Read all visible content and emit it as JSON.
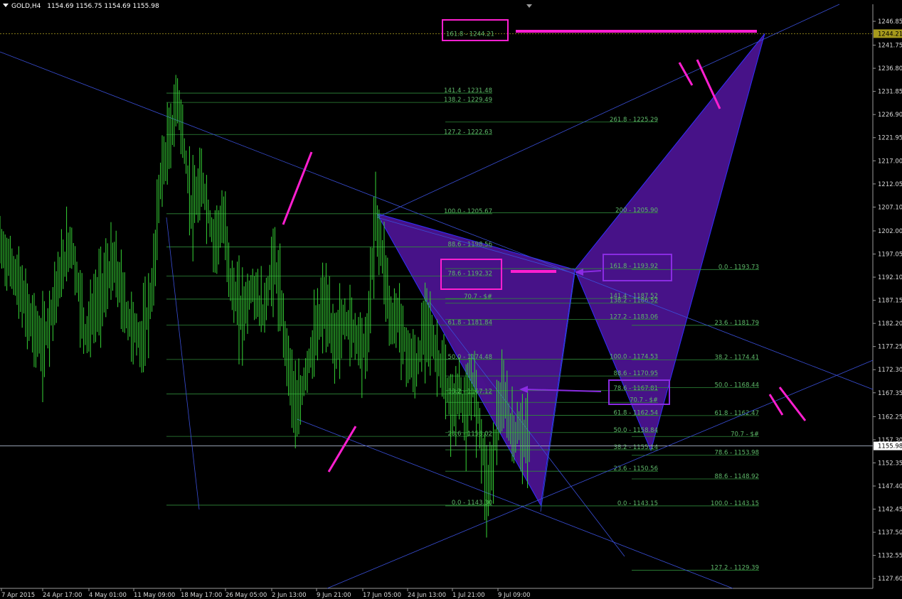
{
  "header": {
    "symbol": "GOLD,H4",
    "ohlc": "1154.69 1156.75 1154.69 1155.98"
  },
  "chart_data": {
    "type": "candlestick",
    "symbol": "GOLD,H4",
    "ylim": [
      1125.5,
      1250.5
    ],
    "y_ticks": [
      "1246.85",
      "1241.75",
      "1236.80",
      "1231.85",
      "1226.90",
      "1221.95",
      "1217.00",
      "1212.05",
      "1207.10",
      "1202.00",
      "1197.05",
      "1192.10",
      "1187.15",
      "1182.20",
      "1177.25",
      "1172.30",
      "1167.35",
      "1162.25",
      "1157.30",
      "1152.35",
      "1147.40",
      "1142.45",
      "1137.50",
      "1132.55",
      "1127.60"
    ],
    "x_ticks": [
      "7 Apr 2015",
      "24 Apr 17:00",
      "4 May 01:00",
      "11 May 09:00",
      "18 May 17:00",
      "26 May 05:00",
      "2 Jun 13:00",
      "9 Jun 21:00",
      "17 Jun 05:00",
      "24 Jun 13:00",
      "1 Jul 21:00",
      "9 Jul 09:00"
    ],
    "current_price": "1155.98",
    "target_price": "1244.21",
    "fib_set_1": [
      {
        "label": "141.4 - 1231.48",
        "value": 1231.48
      },
      {
        "label": "138.2 - 1229.49",
        "value": 1229.49
      },
      {
        "label": "127.2 - 1222.63",
        "value": 1222.63
      },
      {
        "label": "100.0 - 1205.67",
        "value": 1205.67
      },
      {
        "label": "88.6 - 1198.56",
        "value": 1198.56
      },
      {
        "label": "78.6 - 1192.32",
        "value": 1192.32
      },
      {
        "label": "70.7 - $#",
        "value": 1187.4
      },
      {
        "label": "61.8 - 1181.84",
        "value": 1181.84
      },
      {
        "label": "50.0 - 1174.48",
        "value": 1174.48
      },
      {
        "label": "38.2 - 1167.12",
        "value": 1167.12
      },
      {
        "label": "23.6 - 1158.02",
        "value": 1158.02
      },
      {
        "label": "0.0 - 1143.30",
        "value": 1143.3
      }
    ],
    "fib_set_2": [
      {
        "label": "261.8 - 1225.29",
        "value": 1225.29
      },
      {
        "label": "200 - 1205.90",
        "value": 1205.9
      },
      {
        "label": "161.8 - 1193.92",
        "value": 1193.92
      },
      {
        "label": "141.4 - 1187.52",
        "value": 1187.52
      },
      {
        "label": "138.2 - 1186.52",
        "value": 1186.52
      },
      {
        "label": "127.2 - 1183.06",
        "value": 1183.06
      },
      {
        "label": "100.0 - 1174.53",
        "value": 1174.53
      },
      {
        "label": "88.6 - 1170.95",
        "value": 1170.95
      },
      {
        "label": "78.6 - 1167.81",
        "value": 1167.81
      },
      {
        "label": "70.7 - $#",
        "value": 1165.3
      },
      {
        "label": "61.8 - 1162.54",
        "value": 1162.54
      },
      {
        "label": "50.0 - 1158.84",
        "value": 1158.84
      },
      {
        "label": "38.2 - 1155.14",
        "value": 1155.14
      },
      {
        "label": "23.6 - 1150.56",
        "value": 1150.56
      },
      {
        "label": "0.0 - 1143.15",
        "value": 1143.15
      }
    ],
    "fib_set_3": [
      {
        "label": "0.0 - 1193.73",
        "value": 1193.73
      },
      {
        "label": "23.6 - 1181.79",
        "value": 1181.79
      },
      {
        "label": "38.2 - 1174.41",
        "value": 1174.41
      },
      {
        "label": "50.0 - 1168.44",
        "value": 1168.44
      },
      {
        "label": "61.8 - 1162.47",
        "value": 1162.47
      },
      {
        "label": "70.7 - $#",
        "value": 1158.0
      },
      {
        "label": "78.6 - 1153.98",
        "value": 1153.98
      },
      {
        "label": "88.6 - 1148.92",
        "value": 1148.92
      },
      {
        "label": "100.0 - 1143.15",
        "value": 1143.15
      },
      {
        "label": "127.2 - 1129.39",
        "value": 1129.39
      }
    ],
    "target_label": "161.8 - 1244.21",
    "price_path": [
      [
        0,
        1199
      ],
      [
        20,
        1193
      ],
      [
        40,
        1184
      ],
      [
        60,
        1177
      ],
      [
        80,
        1190
      ],
      [
        100,
        1200
      ],
      [
        120,
        1180
      ],
      [
        140,
        1188
      ],
      [
        160,
        1195
      ],
      [
        180,
        1183
      ],
      [
        200,
        1178
      ],
      [
        215,
        1190
      ],
      [
        225,
        1213
      ],
      [
        240,
        1222
      ],
      [
        250,
        1231
      ],
      [
        260,
        1218
      ],
      [
        270,
        1206
      ],
      [
        285,
        1212
      ],
      [
        300,
        1200
      ],
      [
        315,
        1204
      ],
      [
        325,
        1190
      ],
      [
        340,
        1184
      ],
      [
        355,
        1190
      ],
      [
        370,
        1184
      ],
      [
        385,
        1196
      ],
      [
        395,
        1186
      ],
      [
        405,
        1174
      ],
      [
        418,
        1162
      ],
      [
        430,
        1172
      ],
      [
        445,
        1180
      ],
      [
        455,
        1187
      ],
      [
        470,
        1178
      ],
      [
        485,
        1183
      ],
      [
        500,
        1180
      ],
      [
        515,
        1176
      ],
      [
        528,
        1205
      ],
      [
        540,
        1195
      ],
      [
        550,
        1182
      ],
      [
        560,
        1184
      ],
      [
        570,
        1177
      ],
      [
        585,
        1172
      ],
      [
        600,
        1184
      ],
      [
        610,
        1177
      ],
      [
        625,
        1170
      ],
      [
        635,
        1163
      ],
      [
        645,
        1168
      ],
      [
        655,
        1162
      ],
      [
        665,
        1170
      ],
      [
        675,
        1160
      ],
      [
        685,
        1146
      ],
      [
        692,
        1152
      ],
      [
        700,
        1163
      ],
      [
        710,
        1166
      ],
      [
        720,
        1158
      ],
      [
        730,
        1160
      ],
      [
        745,
        1156
      ]
    ]
  }
}
